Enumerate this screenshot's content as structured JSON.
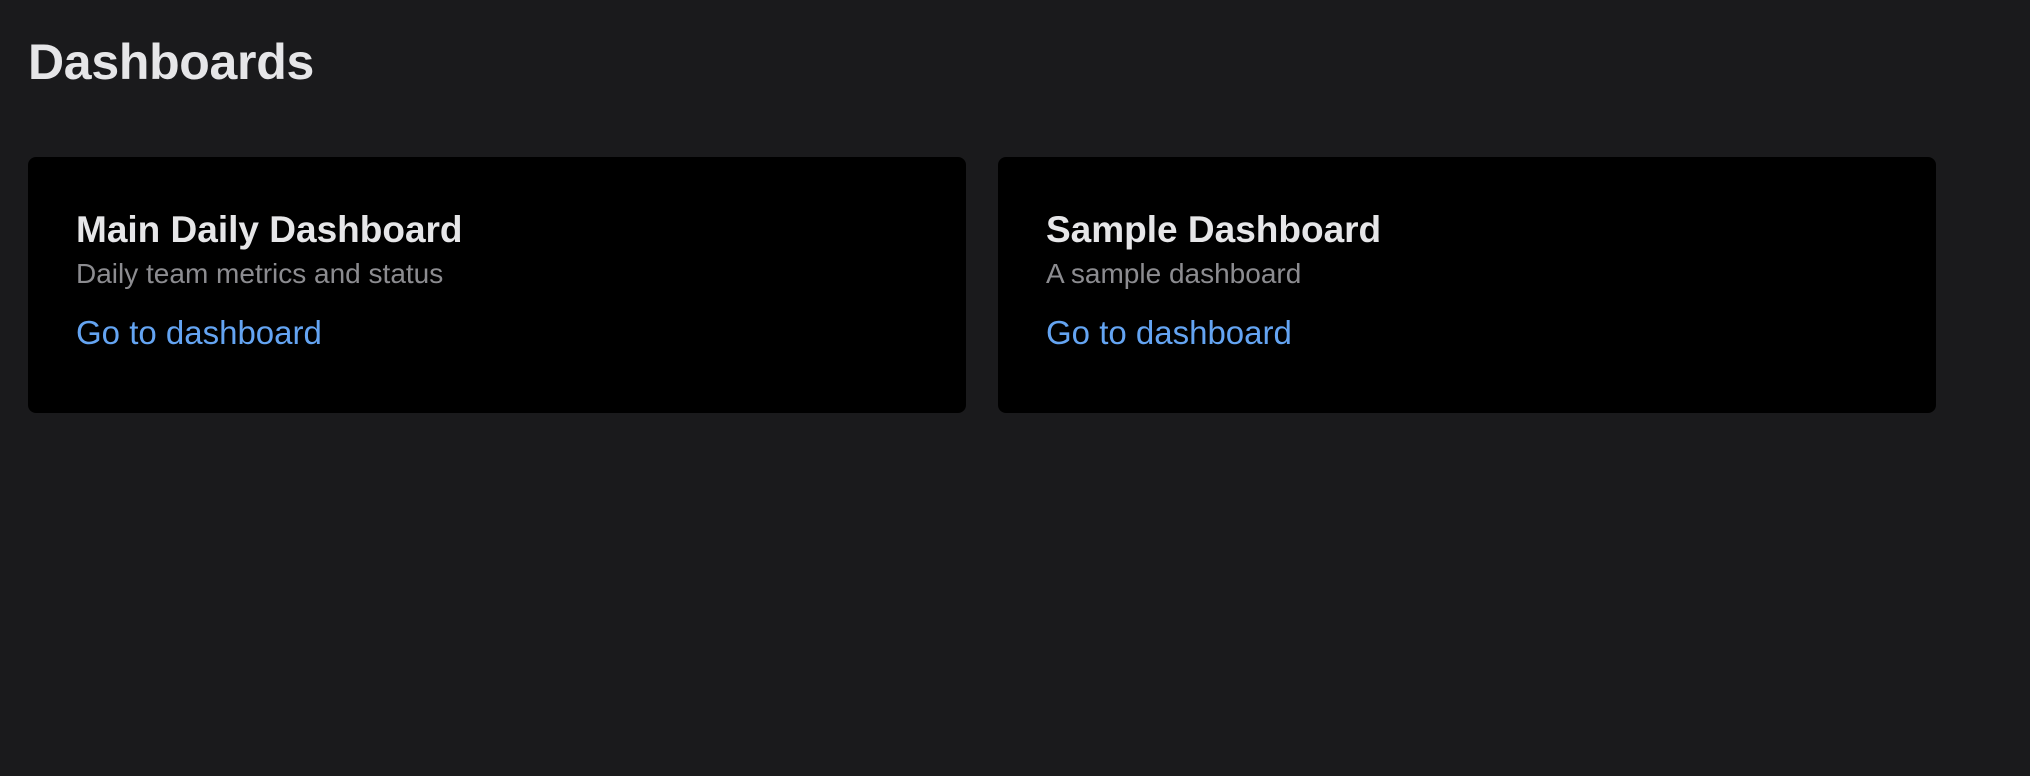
{
  "page": {
    "title": "Dashboards"
  },
  "dashboards": [
    {
      "title": "Main Daily Dashboard",
      "description": "Daily team metrics and status",
      "link_label": "Go to dashboard"
    },
    {
      "title": "Sample Dashboard",
      "description": "A sample dashboard",
      "link_label": "Go to dashboard"
    }
  ],
  "colors": {
    "background": "#1a1a1c",
    "card_background": "#000000",
    "title_text": "#e6e6e8",
    "muted_text": "#8c8c90",
    "link": "#64a4f2"
  }
}
